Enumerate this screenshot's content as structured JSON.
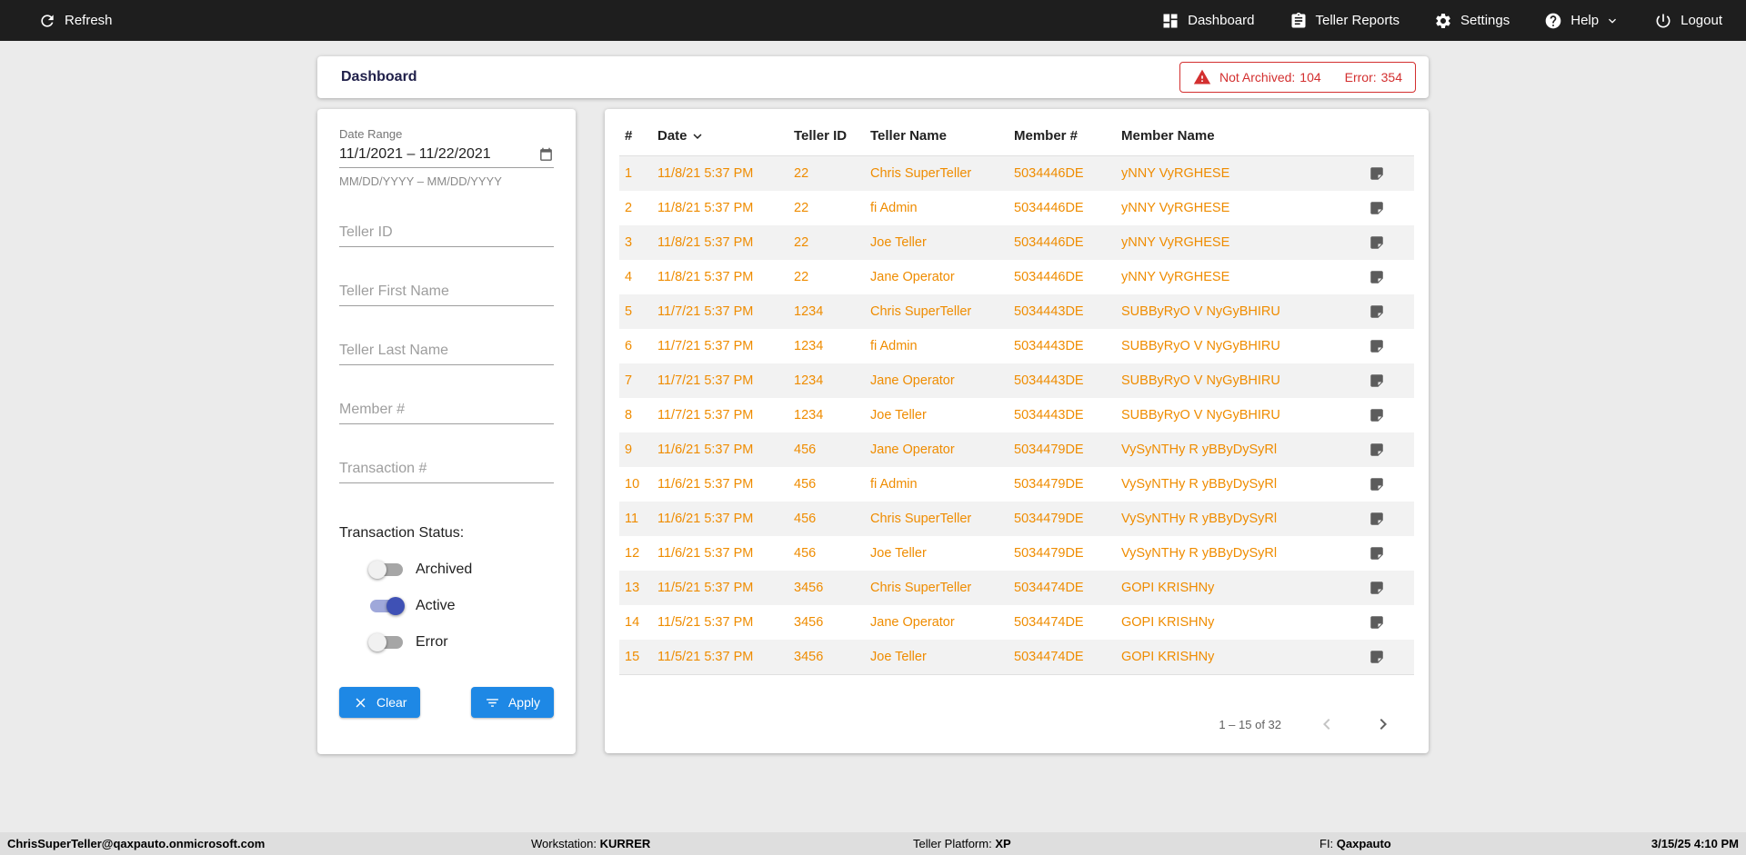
{
  "topbar": {
    "refresh_label": "Refresh",
    "nav": [
      {
        "label": "Dashboard"
      },
      {
        "label": "Teller Reports"
      },
      {
        "label": "Settings"
      },
      {
        "label": "Help"
      },
      {
        "label": "Logout"
      }
    ]
  },
  "header": {
    "title": "Dashboard",
    "alert": {
      "not_archived_label": "Not Archived:",
      "not_archived_count": "104",
      "error_label": "Error:",
      "error_count": "354"
    }
  },
  "filters": {
    "date_range": {
      "label": "Date Range",
      "value": "11/1/2021 – 11/22/2021",
      "hint": "MM/DD/YYYY – MM/DD/YYYY"
    },
    "fields": [
      {
        "placeholder": "Teller ID"
      },
      {
        "placeholder": "Teller First Name"
      },
      {
        "placeholder": "Teller Last Name"
      },
      {
        "placeholder": "Member #"
      },
      {
        "placeholder": "Transaction #"
      }
    ],
    "status": {
      "label": "Transaction Status:",
      "toggles": [
        {
          "label": "Archived",
          "on": false
        },
        {
          "label": "Active",
          "on": true
        },
        {
          "label": "Error",
          "on": false
        }
      ]
    },
    "clear_label": "Clear",
    "apply_label": "Apply"
  },
  "table": {
    "columns": [
      "#",
      "Date",
      "Teller ID",
      "Teller Name",
      "Member #",
      "Member Name"
    ],
    "rows": [
      [
        "1",
        "11/8/21 5:37 PM",
        "22",
        "Chris SuperTeller",
        "5034446DE",
        "yNNY VyRGHESE"
      ],
      [
        "2",
        "11/8/21 5:37 PM",
        "22",
        "fi Admin",
        "5034446DE",
        "yNNY VyRGHESE"
      ],
      [
        "3",
        "11/8/21 5:37 PM",
        "22",
        "Joe Teller",
        "5034446DE",
        "yNNY VyRGHESE"
      ],
      [
        "4",
        "11/8/21 5:37 PM",
        "22",
        "Jane Operator",
        "5034446DE",
        "yNNY VyRGHESE"
      ],
      [
        "5",
        "11/7/21 5:37 PM",
        "1234",
        "Chris SuperTeller",
        "5034443DE",
        "SUBByRyO V NyGyBHIRU"
      ],
      [
        "6",
        "11/7/21 5:37 PM",
        "1234",
        "fi Admin",
        "5034443DE",
        "SUBByRyO V NyGyBHIRU"
      ],
      [
        "7",
        "11/7/21 5:37 PM",
        "1234",
        "Jane Operator",
        "5034443DE",
        "SUBByRyO V NyGyBHIRU"
      ],
      [
        "8",
        "11/7/21 5:37 PM",
        "1234",
        "Joe Teller",
        "5034443DE",
        "SUBByRyO V NyGyBHIRU"
      ],
      [
        "9",
        "11/6/21 5:37 PM",
        "456",
        "Jane Operator",
        "5034479DE",
        "VySyNTHy R yBByDySyRl"
      ],
      [
        "10",
        "11/6/21 5:37 PM",
        "456",
        "fi Admin",
        "5034479DE",
        "VySyNTHy R yBByDySyRl"
      ],
      [
        "11",
        "11/6/21 5:37 PM",
        "456",
        "Chris SuperTeller",
        "5034479DE",
        "VySyNTHy R yBByDySyRl"
      ],
      [
        "12",
        "11/6/21 5:37 PM",
        "456",
        "Joe Teller",
        "5034479DE",
        "VySyNTHy R yBByDySyRl"
      ],
      [
        "13",
        "11/5/21 5:37 PM",
        "3456",
        "Chris SuperTeller",
        "5034474DE",
        "GOPI KRISHNy"
      ],
      [
        "14",
        "11/5/21 5:37 PM",
        "3456",
        "Jane Operator",
        "5034474DE",
        "GOPI KRISHNy"
      ],
      [
        "15",
        "11/5/21 5:37 PM",
        "3456",
        "Joe Teller",
        "5034474DE",
        "GOPI KRISHNy"
      ]
    ],
    "pagination": {
      "range": "1 – 15 of 32"
    }
  },
  "statusbar": {
    "user": "ChrisSuperTeller@qaxpauto.onmicrosoft.com",
    "workstation_label": "Workstation:",
    "workstation": "KURRER",
    "platform_label": "Teller Platform:",
    "platform": "XP",
    "fi_label": "FI:",
    "fi": "Qaxpauto",
    "datetime": "3/15/25 4:10 PM"
  },
  "colors": {
    "accent_orange": "#ef8c00",
    "button_blue": "#1e88e5",
    "toggle_blue": "#3f51b5",
    "alert_red": "#d32f2f",
    "topbar_bg": "#1e1e1e"
  }
}
